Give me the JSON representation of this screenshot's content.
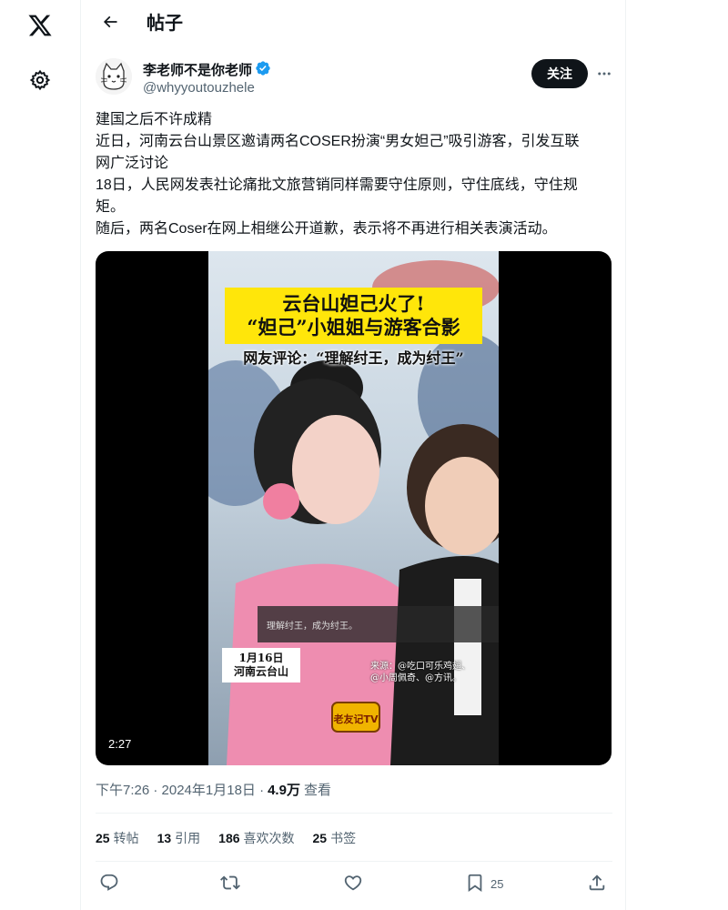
{
  "header": {
    "title": "帖子"
  },
  "author": {
    "name": "李老师不是你老师",
    "handle": "@whyyoutouzhele",
    "follow_label": "关注"
  },
  "tweet": {
    "lines": [
      "建国之后不许成精",
      "近日，河南云台山景区邀请两名COSER扮演“男女妲己”吸引游客，引发互联",
      "网广泛讨论",
      "18日，人民网发表社论痛批文旅营销同样需要守住原则，守住底线，守住规",
      "矩。",
      "随后，两名Coser在网上相继公开道歉，表示将不再进行相关表演活动。"
    ]
  },
  "media": {
    "duration": "2:27",
    "banner_line1": "云台山妲己火了!",
    "banner_line2": "“妲己”小姐姐与游客合影",
    "sub_caption": "网友评论：“理解纣王，成为纣王”",
    "date_line1": "1月16日",
    "date_line2": "河南云台山",
    "source_line1": "来源：@吃口可乐鸡翅、",
    "source_line2": "@小周佩奇、@方讯。",
    "comment_text": "理解纣王，成为纣王。",
    "logo_text": "老友记TV"
  },
  "meta": {
    "time": "下午7:26 · 2024年1月18日 ·",
    "views_count": "4.9万",
    "views_label": "查看"
  },
  "stats": {
    "retweets_count": "25",
    "retweets_label": "转帖",
    "quotes_count": "13",
    "quotes_label": "引用",
    "likes_count": "186",
    "likes_label": "喜欢次数",
    "bookmarks_count": "25",
    "bookmarks_label": "书签"
  },
  "actions": {
    "bookmark_count": "25"
  },
  "icons": {
    "rail": [
      "x-logo-icon",
      "gear-icon"
    ],
    "actions": [
      "reply-icon",
      "retweet-icon",
      "like-icon",
      "bookmark-icon",
      "share-icon"
    ],
    "verified_color": "#1d9bf0"
  }
}
